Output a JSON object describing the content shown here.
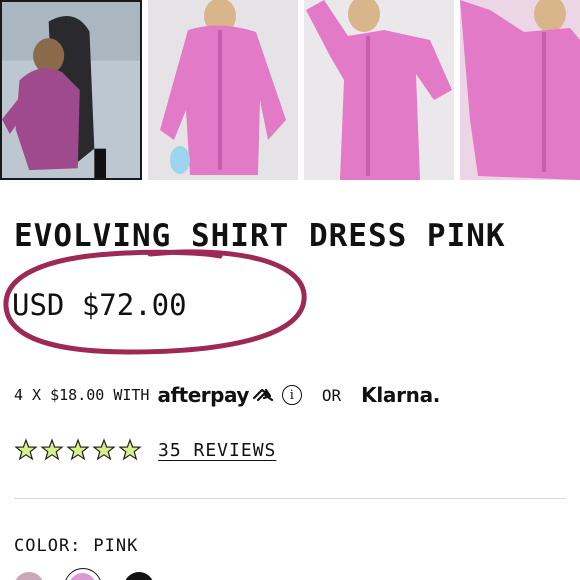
{
  "product": {
    "title": "EVOLVING SHIRT DRESS PINK",
    "price": "USD $72.00"
  },
  "installments": {
    "text": "4 X $18.00 WITH",
    "afterpay_logo": "afterpay",
    "info_icon": "info-circle-icon",
    "or": "OR",
    "klarna_logo": "Klarna."
  },
  "rating": {
    "stars_total": 5,
    "stars_filled": 0,
    "reviews_label": "35 REVIEWS",
    "star_color": "#d8f08a"
  },
  "color": {
    "label": "COLOR:",
    "selected": "PINK",
    "swatches": [
      "#caa9b7",
      "#d99ad0",
      "#111111"
    ],
    "selected_index": 1
  },
  "gallery": {
    "selected_index": 0
  },
  "colors": {
    "annotation_circle": "#9c2a54",
    "dress_pink": "#e27ac8"
  }
}
